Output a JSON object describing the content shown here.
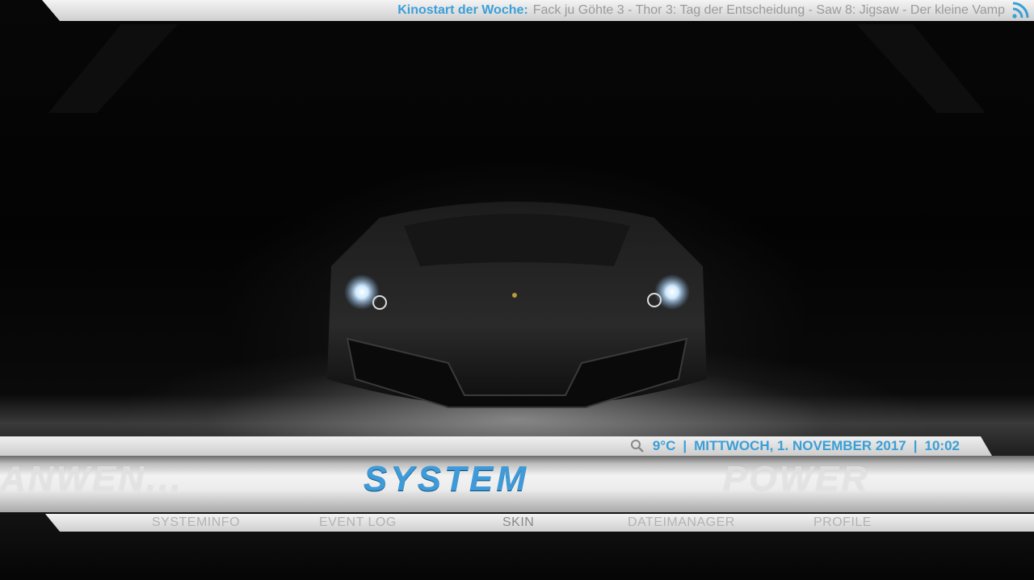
{
  "ticker": {
    "label": "Kinostart der Woche:",
    "text": "Fack ju Göhte 3 - Thor 3: Tag der Entscheidung - Saw 8: Jigsaw - Der kleine Vamp",
    "icon": "rss-icon"
  },
  "status": {
    "temperature": "9°C",
    "separator": "|",
    "date": "MITTWOCH, 1. NOVEMBER 2017",
    "time": "10:02",
    "icon": "search-icon"
  },
  "main_menu": {
    "prev": "ANWEN...",
    "active": "SYSTEM",
    "next": "POWER"
  },
  "submenu": [
    "SYSTEMINFO",
    "EVENT LOG",
    "SKIN",
    "DATEIMANAGER",
    "PROFILE"
  ],
  "colors": {
    "accent": "#3a9fd6",
    "bar": "#e6e6e6"
  }
}
